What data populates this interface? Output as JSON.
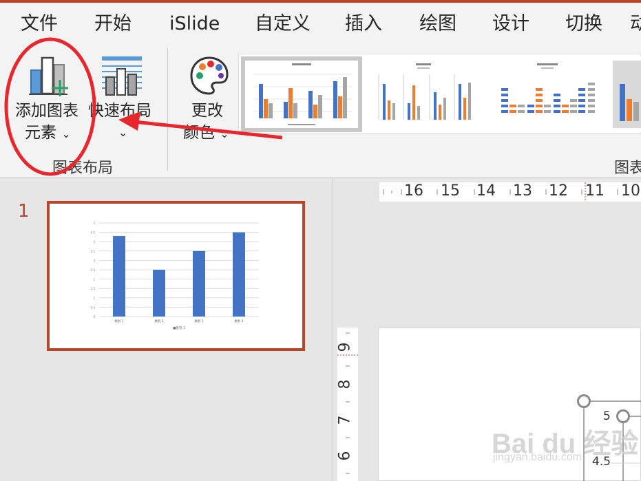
{
  "ribbon_tabs": [
    "文件",
    "开始",
    "iSlide",
    "自定义",
    "插入",
    "绘图",
    "设计",
    "切换",
    "动"
  ],
  "ribbon": {
    "add_chart_element": {
      "line1": "添加图表",
      "line2": "元素",
      "chev": "⌄"
    },
    "quick_layout": {
      "label": "快速布局",
      "chev": "⌄"
    },
    "change_color": {
      "line1": "更改",
      "line2": "颜色",
      "chev": "⌄"
    },
    "group_chart_layout": "图表布局",
    "group_chart_styles": "图表"
  },
  "slides": [
    {
      "number": "1"
    }
  ],
  "thumbnail_chart": {
    "title": "",
    "categories": [
      "类别 1",
      "类别 2",
      "类别 3",
      "类别 4"
    ],
    "values": [
      4.3,
      2.5,
      3.5,
      4.5
    ],
    "ylim": [
      0,
      5
    ],
    "yticks": [
      "0",
      "0.5",
      "1",
      "1.5",
      "2",
      "2.5",
      "3",
      "3.5",
      "4",
      "4.5",
      "5"
    ],
    "legend": "■系列 1",
    "color": "#4472c4"
  },
  "hruler_labels": [
    "16",
    "15",
    "14",
    "13",
    "12",
    "11",
    "10"
  ],
  "vruler_labels": [
    "9",
    "8",
    "7",
    "6"
  ],
  "canvas_axis_labels": [
    "5",
    "4.5"
  ],
  "watermark": {
    "logo": "Bai du 经验",
    "url": "jingyan.baidu.com"
  },
  "colors": {
    "accent": "#b7472a",
    "bar_blue": "#4472c4",
    "bar_orange": "#ed7d31",
    "bar_gray": "#a5a5a5",
    "annotation_red": "#e8262d"
  }
}
